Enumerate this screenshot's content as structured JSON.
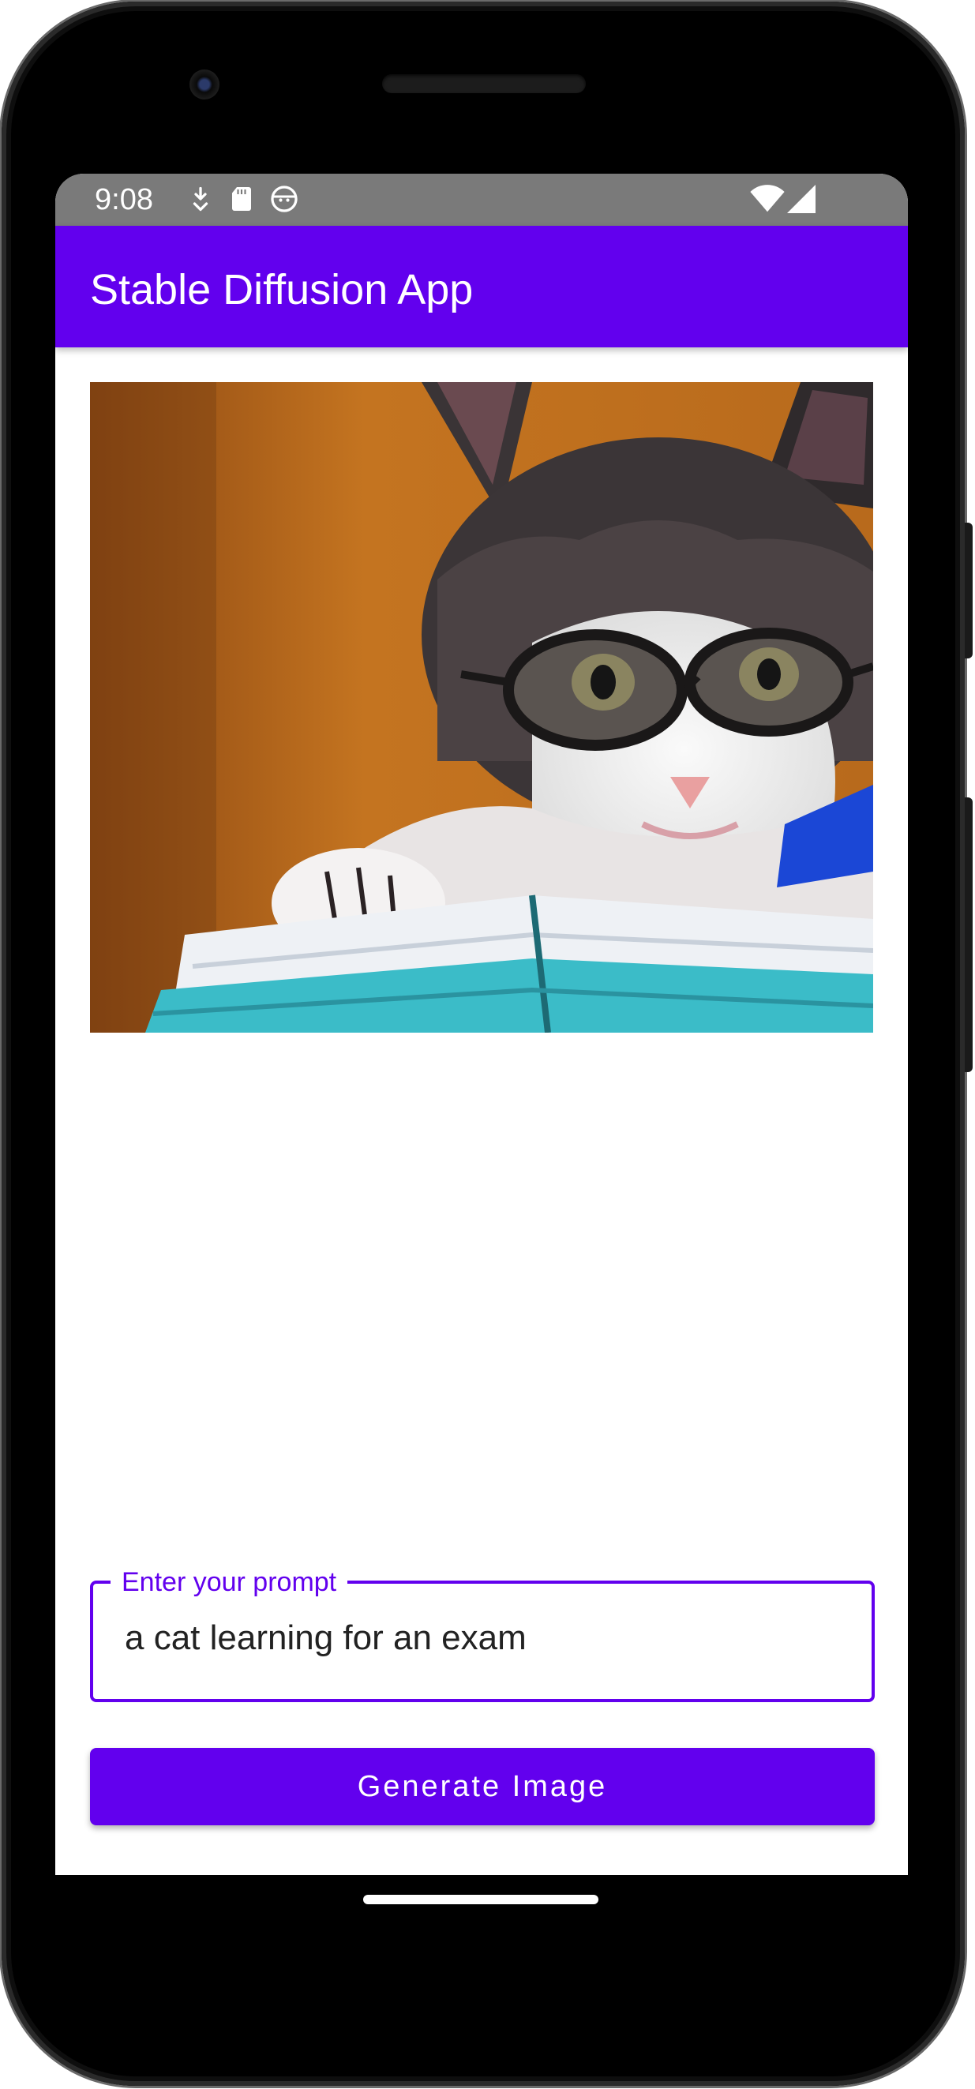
{
  "status_bar": {
    "time": "9:08",
    "icons_left": [
      "bell-download-icon",
      "sd-card-icon",
      "face-icon"
    ],
    "icons_right": [
      "wifi-icon",
      "signal-icon"
    ]
  },
  "app_bar": {
    "title": "Stable Diffusion App",
    "color": "#6200ee"
  },
  "image": {
    "description_icon": "generated-image"
  },
  "prompt": {
    "label": "Enter your prompt",
    "value": "a cat learning for an exam"
  },
  "actions": {
    "generate_label": "Generate Image"
  }
}
